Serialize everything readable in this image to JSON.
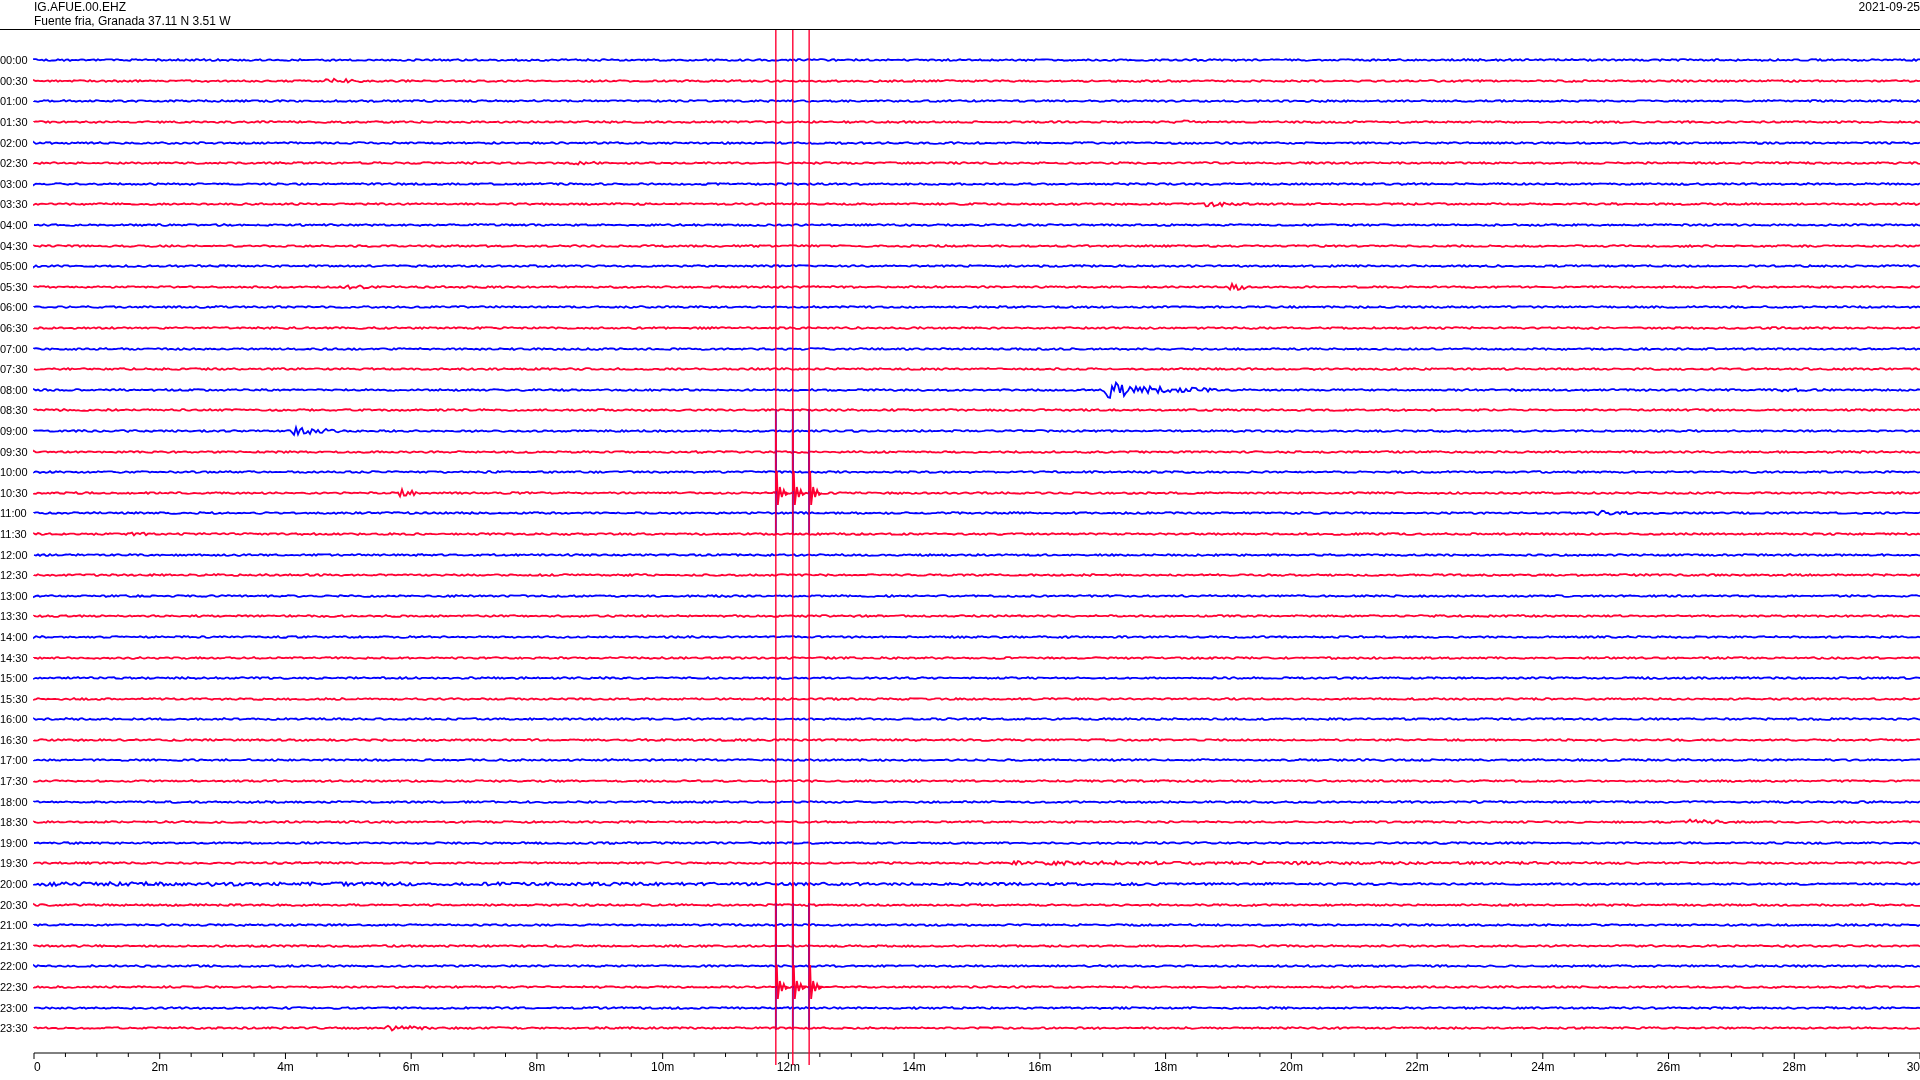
{
  "header": {
    "station": "IG.AFUE.00.EHZ",
    "location": "Fuente fria, Granada  37.11 N 3.51 W",
    "date": "2021-09-25"
  },
  "traces": [
    {
      "time": "00:00",
      "color": "#0000ff"
    },
    {
      "time": "00:30",
      "color": "#ff0033"
    },
    {
      "time": "01:00",
      "color": "#0000ff"
    },
    {
      "time": "01:30",
      "color": "#ff0033"
    },
    {
      "time": "02:00",
      "color": "#0000ff"
    },
    {
      "time": "02:30",
      "color": "#ff0033"
    },
    {
      "time": "03:00",
      "color": "#0000ff"
    },
    {
      "time": "03:30",
      "color": "#ff0033"
    },
    {
      "time": "04:00",
      "color": "#0000ff"
    },
    {
      "time": "04:30",
      "color": "#ff0033"
    },
    {
      "time": "05:00",
      "color": "#0000ff"
    },
    {
      "time": "05:30",
      "color": "#ff0033"
    },
    {
      "time": "06:00",
      "color": "#0000ff"
    },
    {
      "time": "06:30",
      "color": "#ff0033"
    },
    {
      "time": "07:00",
      "color": "#0000ff"
    },
    {
      "time": "07:30",
      "color": "#ff0033"
    },
    {
      "time": "08:00",
      "color": "#0000ff"
    },
    {
      "time": "08:30",
      "color": "#ff0033"
    },
    {
      "time": "09:00",
      "color": "#0000ff"
    },
    {
      "time": "09:30",
      "color": "#ff0033"
    },
    {
      "time": "10:00",
      "color": "#0000ff"
    },
    {
      "time": "10:30",
      "color": "#ff0033"
    },
    {
      "time": "11:00",
      "color": "#0000ff"
    },
    {
      "time": "11:30",
      "color": "#ff0033"
    },
    {
      "time": "12:00",
      "color": "#0000ff"
    },
    {
      "time": "12:30",
      "color": "#ff0033"
    },
    {
      "time": "13:00",
      "color": "#0000ff"
    },
    {
      "time": "13:30",
      "color": "#ff0033"
    },
    {
      "time": "14:00",
      "color": "#0000ff"
    },
    {
      "time": "14:30",
      "color": "#ff0033"
    },
    {
      "time": "15:00",
      "color": "#0000ff"
    },
    {
      "time": "15:30",
      "color": "#ff0033"
    },
    {
      "time": "16:00",
      "color": "#0000ff"
    },
    {
      "time": "16:30",
      "color": "#ff0033"
    },
    {
      "time": "17:00",
      "color": "#0000ff"
    },
    {
      "time": "17:30",
      "color": "#ff0033"
    },
    {
      "time": "18:00",
      "color": "#0000ff"
    },
    {
      "time": "18:30",
      "color": "#ff0033"
    },
    {
      "time": "19:00",
      "color": "#0000ff"
    },
    {
      "time": "19:30",
      "color": "#ff0033"
    },
    {
      "time": "20:00",
      "color": "#0000ff"
    },
    {
      "time": "20:30",
      "color": "#ff0033"
    },
    {
      "time": "21:00",
      "color": "#0000ff"
    },
    {
      "time": "21:30",
      "color": "#ff0033"
    },
    {
      "time": "22:00",
      "color": "#0000ff"
    },
    {
      "time": "22:30",
      "color": "#ff0033"
    },
    {
      "time": "23:00",
      "color": "#0000ff"
    },
    {
      "time": "23:30",
      "color": "#ff0033"
    }
  ],
  "axis": {
    "labels": [
      "0",
      "2m",
      "4m",
      "6m",
      "8m",
      "10m",
      "12m",
      "14m",
      "16m",
      "18m",
      "20m",
      "22m",
      "24m",
      "26m",
      "28m",
      "30"
    ]
  }
}
